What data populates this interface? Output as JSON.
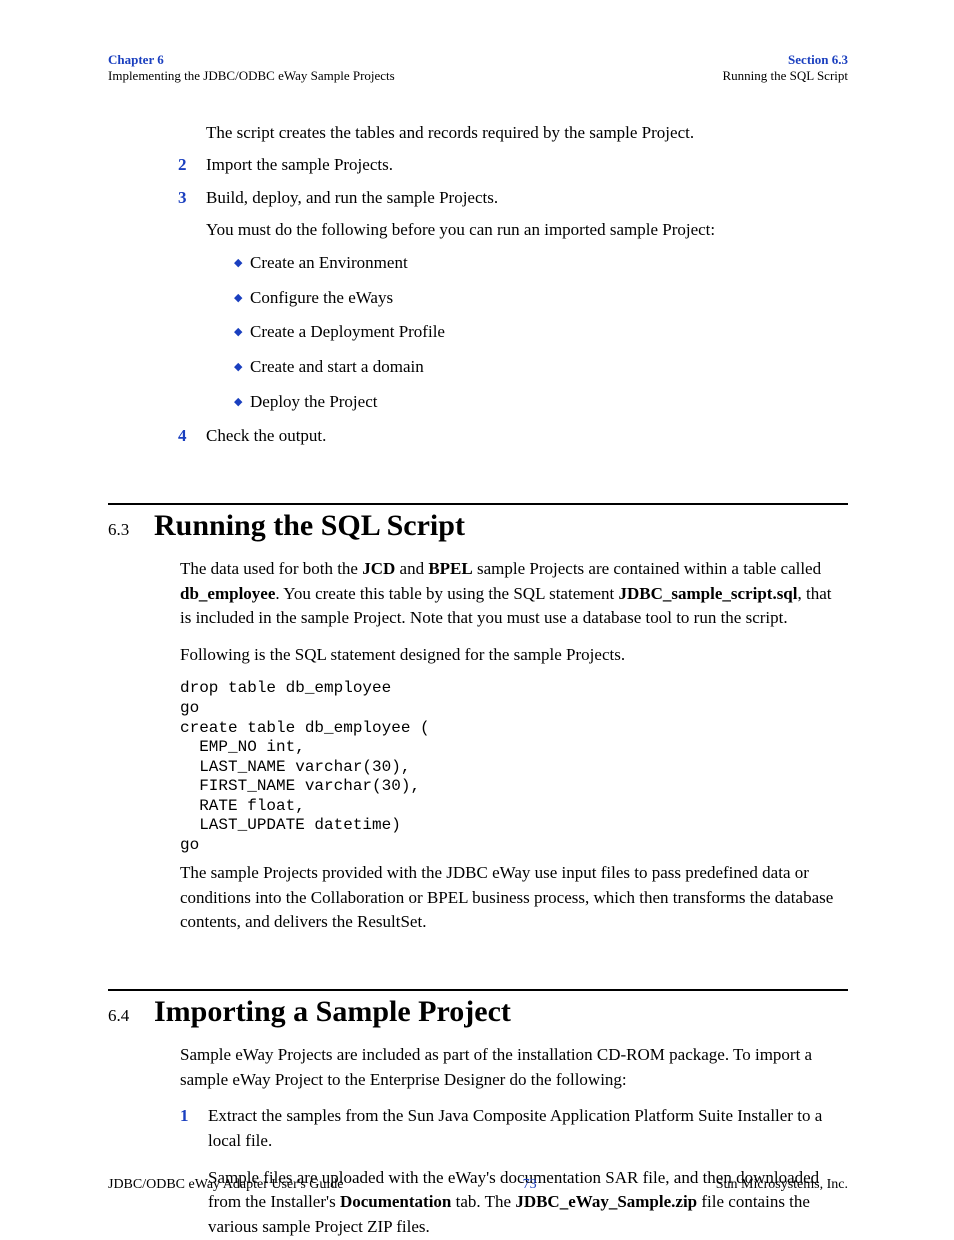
{
  "header": {
    "left_top": "Chapter 6",
    "left_sub": "Implementing the JDBC/ODBC eWay Sample Projects",
    "right_top": "Section 6.3",
    "right_sub": "Running the SQL Script"
  },
  "intro_para": "The script creates the tables and records required by the sample Project.",
  "steps": {
    "s2": {
      "num": "2",
      "text": "Import the sample Projects."
    },
    "s3": {
      "num": "3",
      "text1": "Build, deploy, and run the sample Projects.",
      "text2": "You must do the following before you can run an imported sample Project:"
    },
    "bullets": {
      "b1": "Create an Environment",
      "b2": "Configure the eWays",
      "b3": "Create a Deployment Profile",
      "b4": "Create and start a domain",
      "b5": "Deploy the Project"
    },
    "s4": {
      "num": "4",
      "text": "Check the output."
    }
  },
  "sec63": {
    "num": "6.3",
    "title": "Running the SQL Script",
    "p1_a": "The data used for both the ",
    "p1_b": "JCD",
    "p1_c": " and ",
    "p1_d": "BPEL",
    "p1_e": " sample Projects are contained within a table called ",
    "p1_f": "db_employee",
    "p1_g": ". You create this table by using the SQL statement ",
    "p1_h": "JDBC_sample_script.sql",
    "p1_i": ", that is included in the sample Project. Note that you must use a database tool to run the script.",
    "p2": "Following is the SQL statement designed for the sample Projects.",
    "code": "drop table db_employee\ngo\ncreate table db_employee (\n  EMP_NO int,\n  LAST_NAME varchar(30),\n  FIRST_NAME varchar(30),\n  RATE float,\n  LAST_UPDATE datetime)\ngo",
    "p3": "The sample Projects provided with the JDBC eWay use input files to pass predefined data or conditions into the Collaboration or BPEL business process, which then transforms the database contents, and delivers the ResultSet."
  },
  "sec64": {
    "num": "6.4",
    "title": "Importing a Sample Project",
    "p1": "Sample eWay Projects are included as part of the installation CD-ROM package. To import a sample eWay Project to the Enterprise Designer do the following:",
    "step1": {
      "num": "1",
      "t1": "Extract the samples from the Sun Java Composite Application Platform Suite Installer to a local file.",
      "t2_a": "Sample files are uploaded with the eWay's documentation SAR file, and then downloaded from the Installer's ",
      "t2_b": "Documentation",
      "t2_c": " tab. The ",
      "t2_d": "JDBC_eWay_Sample.zip",
      "t2_e": " file contains the various sample Project ZIP files."
    }
  },
  "footer": {
    "left": "JDBC/ODBC eWay Adapter User's Guide",
    "center": "73",
    "right": "Sun Microsystems, Inc."
  }
}
